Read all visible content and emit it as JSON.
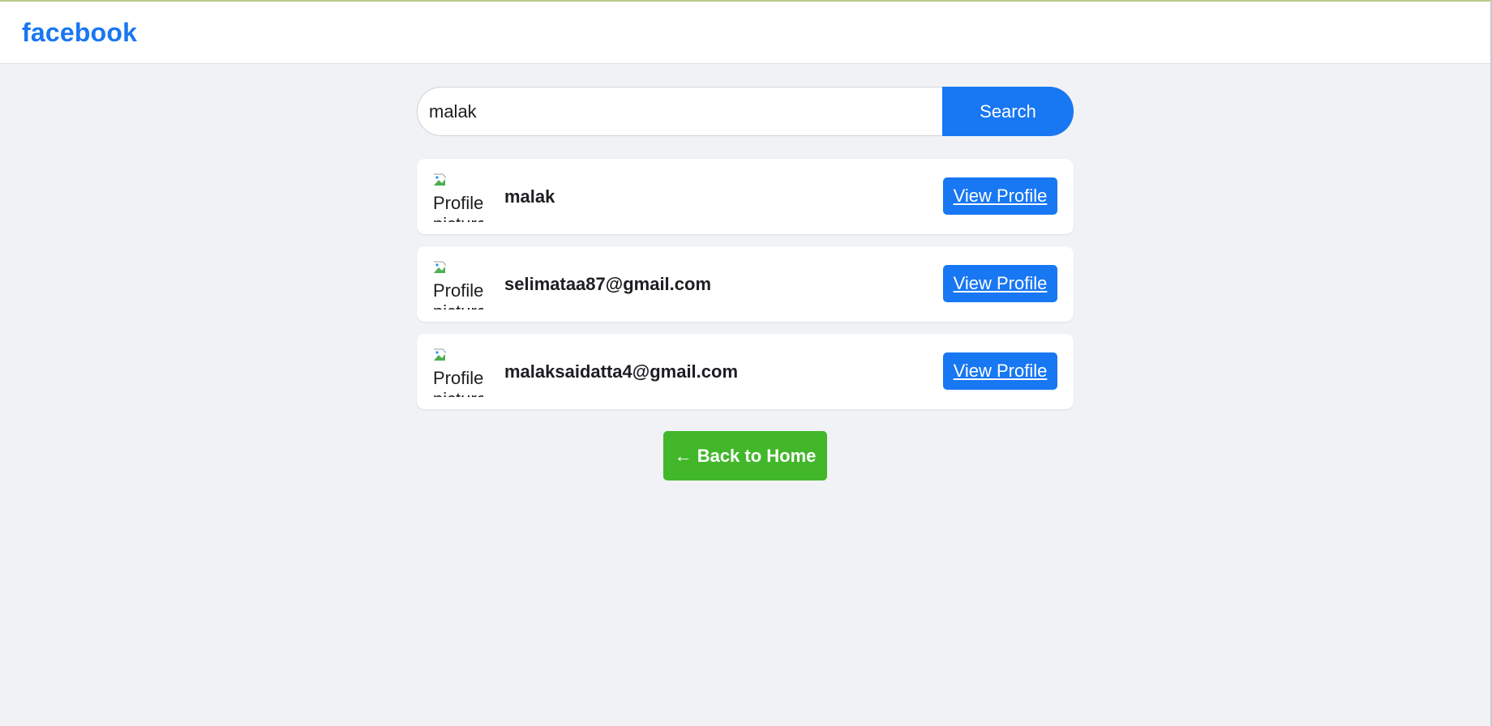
{
  "header": {
    "logo": "facebook"
  },
  "search": {
    "value": "malak",
    "button_label": "Search"
  },
  "results": [
    {
      "avatar_alt": "Profile picture",
      "name": "malak",
      "action_label": "View Profile"
    },
    {
      "avatar_alt": "Profile picture",
      "name": "selimataa87@gmail.com",
      "action_label": "View Profile"
    },
    {
      "avatar_alt": "Profile picture",
      "name": "malaksaidatta4@gmail.com",
      "action_label": "View Profile"
    }
  ],
  "back_button": {
    "label": "← Back to Home"
  },
  "colors": {
    "brand": "#1877f2",
    "success": "#42b72a",
    "background": "#f0f2f5"
  }
}
